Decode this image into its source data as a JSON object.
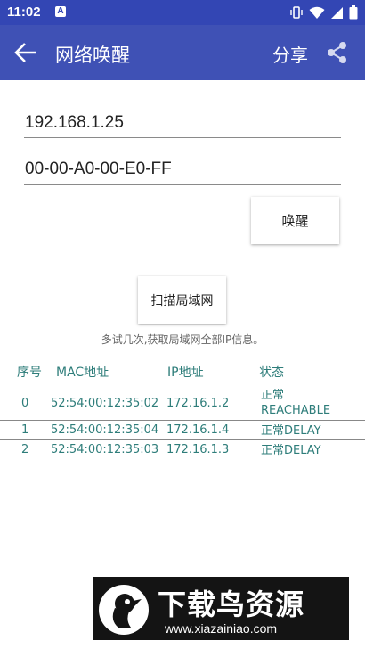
{
  "status_bar": {
    "time": "11:02",
    "notification_badge": "A"
  },
  "app_bar": {
    "title": "网络唤醒",
    "share_label": "分享"
  },
  "form": {
    "ip_value": "192.168.1.25",
    "mac_value": "00-00-A0-00-E0-FF",
    "wake_button": "唤醒"
  },
  "scan": {
    "button_label": "扫描局域网",
    "hint": "多试几次,获取局域网全部IP信息。"
  },
  "table": {
    "headers": [
      "序号",
      "MAC地址",
      "IP地址",
      "状态"
    ],
    "rows": [
      {
        "index": "0",
        "mac": "52:54:00:12:35:02",
        "ip": "172.16.1.2",
        "state_line1": "正常",
        "state_line2": "REACHABLE"
      },
      {
        "index": "1",
        "mac": "52:54:00:12:35:04",
        "ip": "172.16.1.4",
        "state_line1": "正常DELAY",
        "state_line2": ""
      },
      {
        "index": "2",
        "mac": "52:54:00:12:35:03",
        "ip": "172.16.1.3",
        "state_line1": "正常DELAY",
        "state_line2": ""
      }
    ]
  },
  "watermark": {
    "title": "下载鸟资源",
    "url": "www.xiazainiao.com"
  },
  "colors": {
    "app_bar": "#3f51b5",
    "status_bar": "#3346b4",
    "table_text": "#2e7d7a"
  },
  "icons": [
    "vibrate-icon",
    "wifi-icon",
    "signal-icon",
    "battery-icon",
    "back-arrow-icon",
    "share-icon",
    "bird-logo-icon"
  ]
}
